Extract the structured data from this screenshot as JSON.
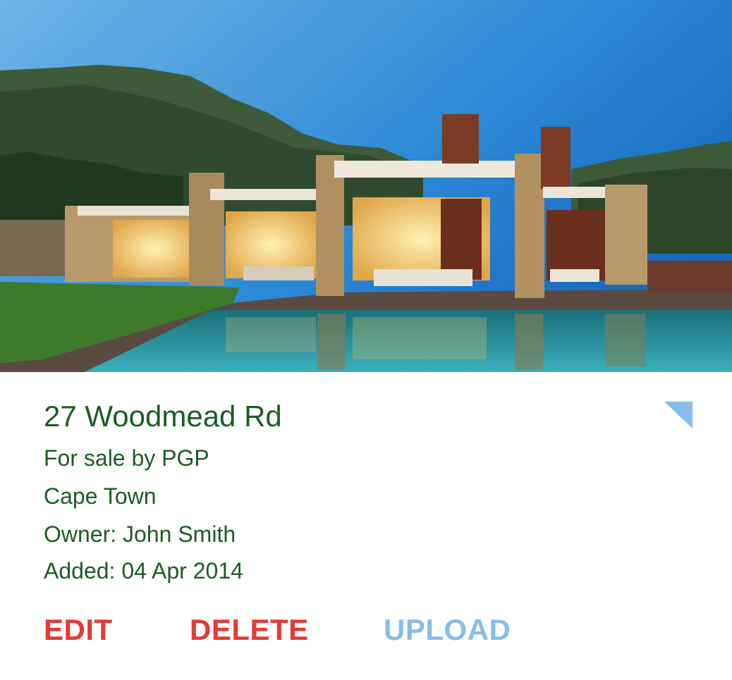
{
  "listing": {
    "address": "27 Woodmead Rd",
    "sale_info": "For sale by PGP",
    "city": "Cape Town",
    "owner": "Owner: John Smith",
    "added": "Added: 04 Apr 2014"
  },
  "actions": {
    "edit_label": "EDIT",
    "delete_label": "DELETE",
    "upload_label": "UPLOAD"
  },
  "colors": {
    "text": "#1b5e20",
    "edit": "#e53935",
    "delete": "#e53935",
    "upload": "#87bde8",
    "corner_marker": "#87bde8"
  },
  "icons": {
    "corner": "corner-triangle-icon"
  }
}
